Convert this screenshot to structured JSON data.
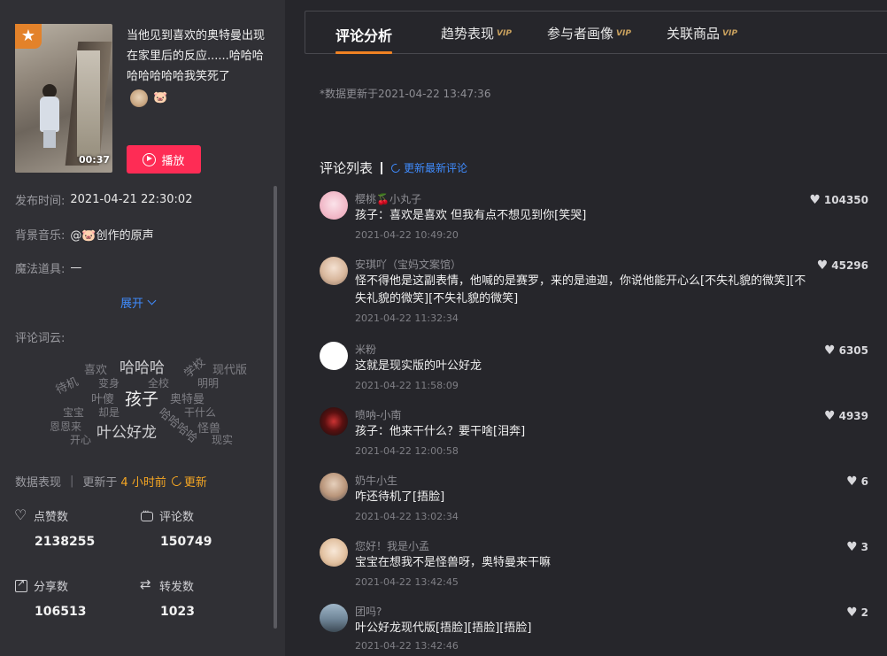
{
  "video": {
    "title": "当他见到喜欢的奥特曼出现在家里后的反应......哈哈哈哈哈哈哈哈我笑死了",
    "duration": "00:37",
    "author_emoji": "🐷",
    "play_label": "播放"
  },
  "meta": {
    "publish_label": "发布时间:",
    "publish_value": "2021-04-21 22:30:02",
    "music_label": "背景音乐:",
    "music_value": "@🐷创作的原声",
    "prop_label": "魔法道具:",
    "prop_value": "—",
    "expand_label": "展开"
  },
  "wordcloud": {
    "label": "评论词云:",
    "words": [
      "喜欢",
      "哈哈哈",
      "学校",
      "现代版",
      "待机",
      "变身",
      "全校",
      "明明",
      "叶傻",
      "孩子",
      "奥特曼",
      "宝宝",
      "却是",
      "哈哈哈哈",
      "干什么",
      "恩恩来",
      "叶公好龙",
      "怪兽",
      "开心",
      "现实"
    ]
  },
  "stats": {
    "label": "数据表现",
    "updated_prefix": "更新于",
    "updated_ago": "4 小时前",
    "refresh_label": "更新",
    "likes_label": "点赞数",
    "likes_value": "2138255",
    "comments_label": "评论数",
    "comments_value": "150749",
    "shares_label": "分享数",
    "shares_value": "106513",
    "reposts_label": "转发数",
    "reposts_value": "1023"
  },
  "tabs": [
    {
      "label": "评论分析"
    },
    {
      "label": "趋势表现"
    },
    {
      "label": "参与者画像"
    },
    {
      "label": "关联商品"
    }
  ],
  "vip_label": "VIP",
  "updated_note": "*数据更新于2021-04-22 13:47:36",
  "comment_list": {
    "title": "评论列表",
    "refresh_label": "更新最新评论",
    "items": [
      {
        "user": "樱桃🍒小丸子",
        "text": "孩子：喜欢是喜欢 但我有点不想见到你[笑哭]",
        "time": "2021-04-22 10:49:20",
        "likes": "104350"
      },
      {
        "user": "安琪吖（宝妈文案馆）",
        "text": "怪不得他是这副表情，他喊的是赛罗，来的是迪迦，你说他能开心么[不失礼貌的微笑][不失礼貌的微笑][不失礼貌的微笑]",
        "time": "2021-04-22 11:32:34",
        "likes": "45296"
      },
      {
        "user": "米粉",
        "text": "这就是现实版的叶公好龙",
        "time": "2021-04-22 11:58:09",
        "likes": "6305"
      },
      {
        "user": "喷呐-小南",
        "text": "孩子：他来干什么？要干啥[泪奔]",
        "time": "2021-04-22 12:00:58",
        "likes": "4939"
      },
      {
        "user": "奶牛小生",
        "text": "咋还待机了[捂脸]",
        "time": "2021-04-22 13:02:34",
        "likes": "6"
      },
      {
        "user": "您好！我是小孟",
        "text": "宝宝在想我不是怪兽呀，奥特曼来干嘛",
        "time": "2021-04-22 13:42:45",
        "likes": "3"
      },
      {
        "user": "团吗?",
        "text": "叶公好龙现代版[捂脸][捂脸][捂脸]",
        "time": "2021-04-22 13:42:46",
        "likes": "2"
      }
    ]
  }
}
